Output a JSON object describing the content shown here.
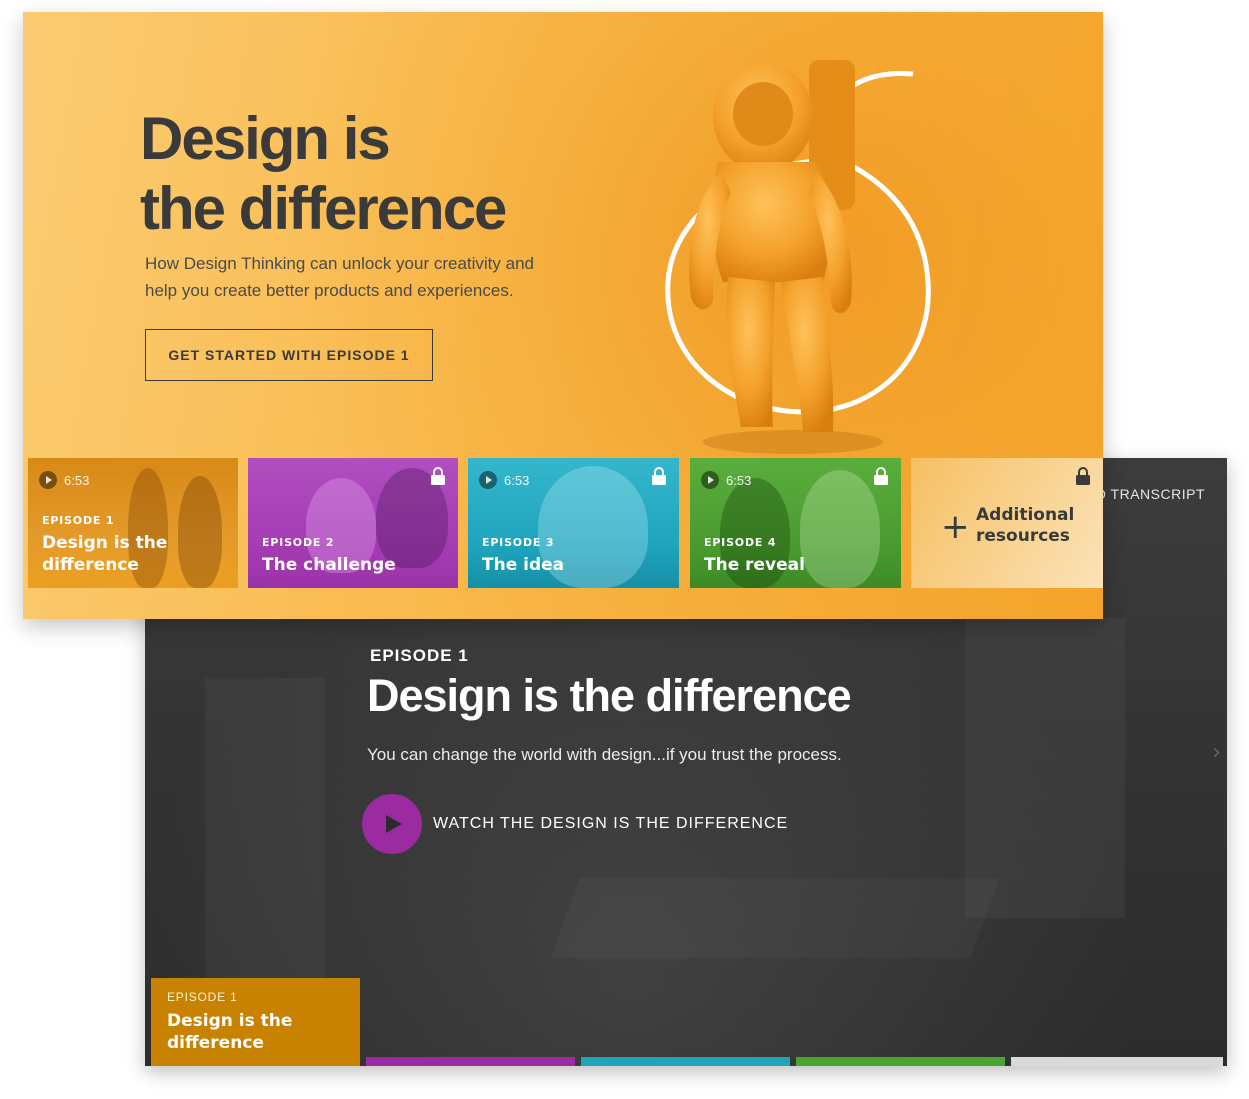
{
  "back_panel": {
    "transcript_label": "O TRANSCRIPT",
    "episode_eyebrow": "EPISODE 1",
    "episode_title": "Design is the difference",
    "episode_description": "You can change the world with design...if you trust the process.",
    "watch_label": "WATCH THE DESIGN IS THE DIFFERENCE",
    "current_card": {
      "eyebrow": "EPISODE 1",
      "title_line1": "Design is the",
      "title_line2": "difference"
    },
    "strip_colors": [
      "#9c2aa0",
      "#1fa5b8",
      "#4aa530",
      "#d9d9d9"
    ]
  },
  "hero": {
    "title_line1": "Design is",
    "title_line2": "the difference",
    "subtitle_line1": "How Design Thinking can unlock your creativity and",
    "subtitle_line2": "help you create better products and experiences.",
    "cta_label": "GET STARTED WITH EPISODE 1"
  },
  "episode_cards": [
    {
      "eyebrow": "EPISODE 1",
      "title_line1": "Design is the",
      "title_line2": "difference",
      "duration": "6:53",
      "locked": false,
      "color": "#e08a12"
    },
    {
      "eyebrow": "EPISODE 2",
      "title_line1": "The challenge",
      "duration": "",
      "locked": true,
      "color": "#a43bb3"
    },
    {
      "eyebrow": "EPISODE 3",
      "title_line1": "The idea",
      "duration": "6:53",
      "locked": true,
      "color": "#1ea3bd"
    },
    {
      "eyebrow": "EPISODE 4",
      "title_line1": "The reveal",
      "duration": "6:53",
      "locked": true,
      "color": "#489a2e"
    }
  ],
  "resources_card": {
    "line1": "Additional",
    "line2": "resources",
    "locked": true
  }
}
